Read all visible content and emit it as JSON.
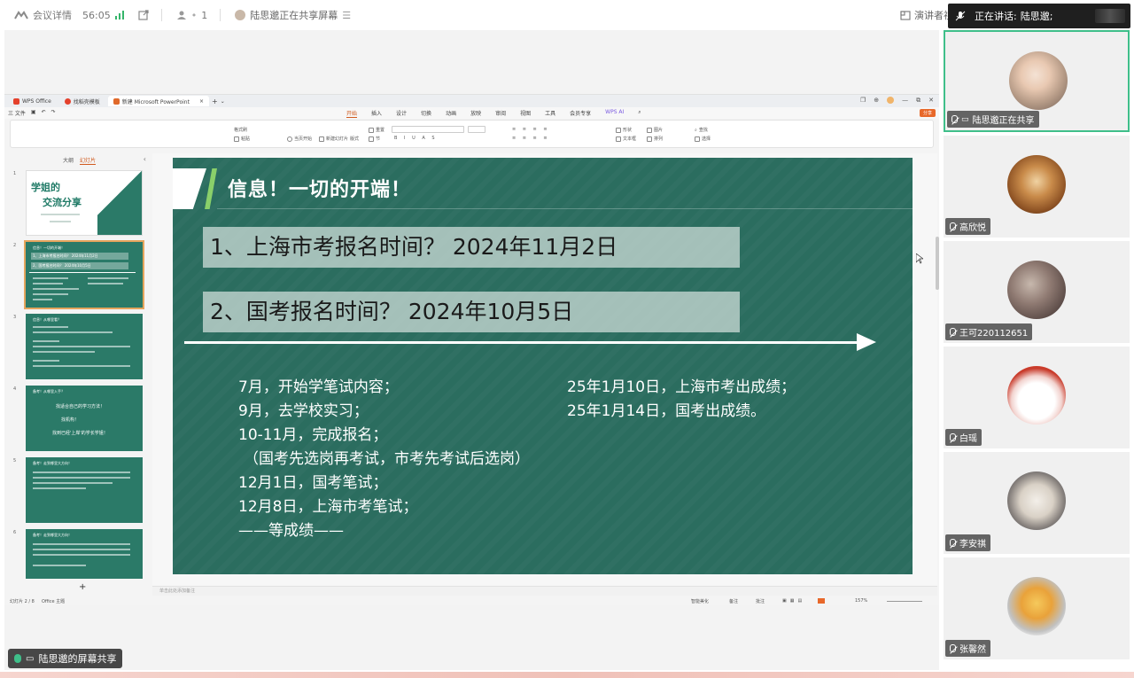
{
  "topbar": {
    "meeting_details": "会议详情",
    "timer": "56:05",
    "participants_count": "1",
    "sharing_status": "陆思邈正在共享屏幕",
    "presenter_view": "演讲者视",
    "speaking_label": "正在讲话:",
    "speaking_name": "陆思邈;"
  },
  "wps": {
    "tabs": [
      {
        "label": "WPS Office"
      },
      {
        "label": "找稻壳模板"
      },
      {
        "label": "新建 Microsoft PowerPoint"
      }
    ],
    "menu_left": "三 文件",
    "menu_items": [
      "开始",
      "插入",
      "设计",
      "切换",
      "动画",
      "放映",
      "审阅",
      "视图",
      "工具",
      "会员专享",
      "WPS AI"
    ],
    "active_menu": "开始",
    "share_btn": "分享",
    "ribbon": {
      "paste": "粘贴",
      "format_painter": "格式刷",
      "from_start": "当页开始",
      "new_slide": "新建幻灯片",
      "layout": "版式",
      "section": "节",
      "reset": "重置",
      "shape": "形状",
      "image": "图片",
      "textbox": "文本框",
      "arrange": "排列",
      "find": "查找",
      "select": "选择"
    },
    "panel_tabs": [
      "大纲",
      "幻灯片"
    ],
    "thumbs": [
      {
        "num": "1",
        "title": "学姐的",
        "title2": "交流分享"
      },
      {
        "num": "2",
        "title": "信息！一切的开端！",
        "line1": "1、上海市考报名时间？ 2024年11月2日",
        "line2": "2、国考报名时间？ 2024年10月5日"
      },
      {
        "num": "3",
        "title": "信息！从哪里看？"
      },
      {
        "num": "4",
        "title": "备考！从哪里入手？",
        "line1": "找适合自己的学习方法！",
        "line2": "找机构！",
        "line3": "找到已经'上岸'的学长学姐！"
      },
      {
        "num": "5",
        "title": "备考！走到哪里大方向！"
      },
      {
        "num": "6",
        "title": "备考！走到哪里大方向！"
      }
    ],
    "status_left": "幻灯片 2 / 8",
    "status_theme": "Office 主题",
    "notes_placeholder": "单击此处添加备注",
    "status_smart": "智能美化",
    "status_notes": "备注",
    "status_comment": "批注",
    "zoom": "157%"
  },
  "slide": {
    "title": "信息！一切的开端！",
    "q1": "1、上海市考报名时间？ 2024年11月2日",
    "q2": "2、国考报名时间？ 2024年10月5日",
    "timeline_left": [
      "7月，开始学笔试内容；",
      "9月，去学校实习；",
      "10-11月，完成报名；",
      "（国考先选岗再考试，市考先考试后选岗）",
      "12月1日，国考笔试；",
      "12月8日，上海市考笔试；",
      "——等成绩——"
    ],
    "timeline_right": [
      "25年1月10日，上海市考出成绩；",
      "25年1月14日，国考出成绩。"
    ]
  },
  "participants": [
    {
      "name": "陆思邈正在共享",
      "avatar": "cat-girl-avatar"
    },
    {
      "name": "高欣悦",
      "avatar": "dog-avatar"
    },
    {
      "name": "王可220112651",
      "avatar": "painting-avatar"
    },
    {
      "name": "白瑶",
      "avatar": "cartoon-avatar"
    },
    {
      "name": "李安祺",
      "avatar": "photo-avatar"
    },
    {
      "name": "张馨然",
      "avatar": "fries-avatar"
    }
  ],
  "share_label": "陆思邈的屏幕共享",
  "colors": {
    "slide_bg": "#2b6d5f",
    "accent_green": "#8ad06a",
    "wps_orange": "#d05a1e",
    "active_border": "#3fbf8a"
  }
}
